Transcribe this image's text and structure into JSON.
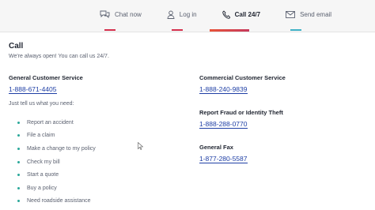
{
  "nav": {
    "tabs": [
      {
        "label": "Chat now",
        "icon": "chat-icon",
        "accent": "#d4304d"
      },
      {
        "label": "Log in",
        "icon": "user-icon",
        "accent": "#d4304d"
      },
      {
        "label": "Call 24/7",
        "icon": "phone-icon",
        "accent": "#e8533a",
        "active": true
      },
      {
        "label": "Send email",
        "icon": "mail-icon",
        "accent": "#3fb1c6"
      }
    ]
  },
  "page": {
    "title": "Call",
    "subtitle": "We're always open! You can call us 24/7.",
    "need_prompt": "Just tell us what you need:"
  },
  "contacts": {
    "general": {
      "name": "General Customer Service",
      "phone": "1-888-671-4405"
    },
    "commercial": {
      "name": "Commercial Customer Service",
      "phone": "1-888-240-9839"
    },
    "fraud": {
      "name": "Report Fraud or Identity Theft",
      "phone": "1-888-288-0770"
    },
    "fax": {
      "name": "General Fax",
      "phone": "1-877-280-5587"
    }
  },
  "needs": [
    "Report an accident",
    "File a claim",
    "Make a change to my policy",
    "Check my bill",
    "Start a quote",
    "Buy a policy",
    "Need roadside assistance"
  ],
  "colors": {
    "link": "#1f3fa5",
    "bullet": "#2aa89a"
  }
}
